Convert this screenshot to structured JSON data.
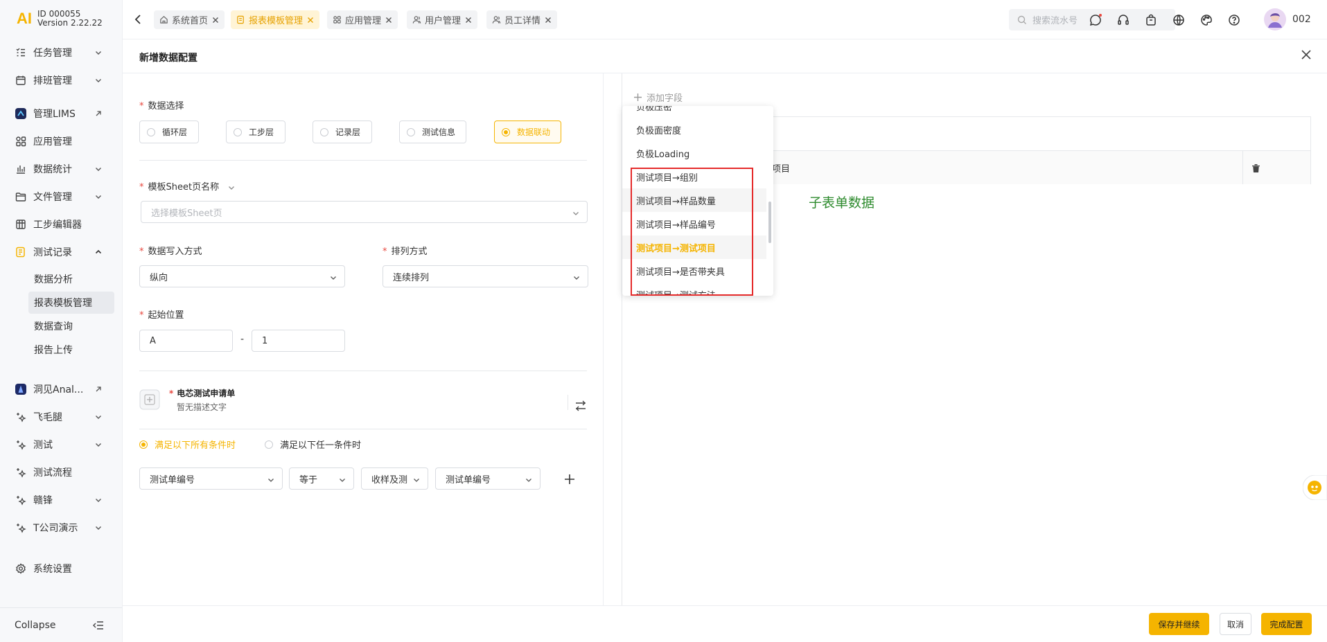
{
  "brand": {
    "logo": "AI",
    "id": "ID 000055",
    "version": "Version 2.22.22"
  },
  "sidebar": {
    "items": [
      {
        "label": "任务管理",
        "icon": "list-check-icon"
      },
      {
        "label": "排班管理",
        "icon": "calendar-icon"
      },
      {
        "label": "管理LIMS",
        "icon": "lims-app-icon"
      },
      {
        "label": "应用管理",
        "icon": "apps-grid-icon"
      },
      {
        "label": "数据统计",
        "icon": "bar-chart-icon"
      },
      {
        "label": "文件管理",
        "icon": "folder-icon"
      },
      {
        "label": "工步编辑器",
        "icon": "table-grid-icon"
      },
      {
        "label": "测试记录",
        "icon": "record-icon"
      }
    ],
    "sub_items": [
      "数据分析",
      "报表模板管理",
      "数据查询",
      "报告上传"
    ],
    "items2": [
      {
        "label": "洞见Anal...",
        "icon": "insight-app-icon"
      },
      {
        "label": "飞毛腿",
        "icon": "sparkle-icon"
      },
      {
        "label": "测试",
        "icon": "sparkle-icon"
      },
      {
        "label": "测试流程",
        "icon": "sparkle-icon"
      },
      {
        "label": "赣锋",
        "icon": "sparkle-icon"
      },
      {
        "label": "T公司演示",
        "icon": "sparkle-icon"
      }
    ],
    "settings": "系统设置",
    "collapse": "Collapse"
  },
  "tabs": [
    {
      "label": "系统首页",
      "active": false
    },
    {
      "label": "报表模板管理",
      "active": true
    },
    {
      "label": "应用管理",
      "active": false
    },
    {
      "label": "用户管理",
      "active": false
    },
    {
      "label": "员工详情",
      "active": false
    }
  ],
  "search": {
    "placeholder": "搜索流水号"
  },
  "user": {
    "name": "002"
  },
  "panel": {
    "title": "新增数据配置"
  },
  "form": {
    "data_select_label": "数据选择",
    "data_options": [
      "循环层",
      "工步层",
      "记录层",
      "测试信息",
      "数据联动"
    ],
    "data_selected": "数据联动",
    "sheet_label": "模板Sheet页名称",
    "sheet_placeholder": "选择模板Sheet页",
    "write_mode_label": "数据写入方式",
    "write_mode_value": "纵向",
    "sort_label": "排列方式",
    "sort_value": "连续排列",
    "start_label": "起始位置",
    "start_col": "A",
    "start_sep": "-",
    "start_row": "1",
    "linked_title": "电芯测试申请单",
    "linked_desc": "暂无描述文字",
    "cond_all": "满足以下所有条件时",
    "cond_any": "满足以下任一条件时",
    "cond_field": "测试单编号",
    "cond_op": "等于",
    "cond_source": "收样及测",
    "cond_target": "测试单编号"
  },
  "right": {
    "add_field": "添加字段",
    "header_partial": "项目",
    "subform_text": "子表单数据"
  },
  "dropdown": {
    "items": [
      "负极压密",
      "负极面密度",
      "负极Loading",
      "测试项目→组别",
      "测试项目→样品数量",
      "测试项目→样品编号",
      "测试项目→测试项目",
      "测试项目→是否带夹具",
      "测试项目→测试方法"
    ],
    "selected_index": 6,
    "hover_index": 4
  },
  "footer": {
    "save_continue": "保存并继续",
    "cancel": "取消",
    "finish": "完成配置"
  },
  "colors": {
    "accent": "#f5b400",
    "highlight_box": "#e52a2a",
    "subform_text": "#2e8b2e"
  }
}
